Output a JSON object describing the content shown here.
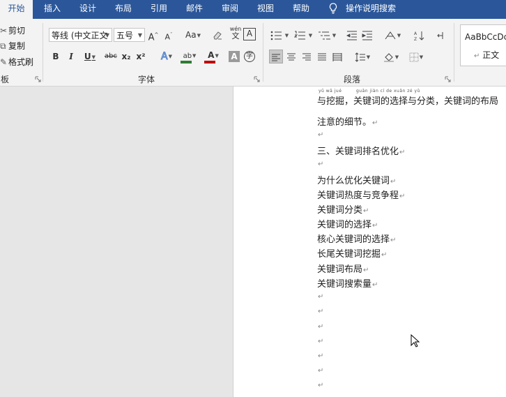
{
  "tabs": [
    "开始",
    "插入",
    "设计",
    "布局",
    "引用",
    "邮件",
    "审阅",
    "视图",
    "帮助"
  ],
  "tell_me": "操作说明搜索",
  "clipboard": {
    "cut": "剪切",
    "copy": "复制",
    "format_painter": "格式刷",
    "group_label": "板"
  },
  "font": {
    "font_name": "等线 (中文正文",
    "font_size": "五号",
    "grow": "A",
    "shrink": "A",
    "change_case": "Aa",
    "phonetic_top": "wén",
    "phonetic_bottom": "文",
    "border_char": "A",
    "bold": "B",
    "italic": "I",
    "underline": "U",
    "strike": "abc",
    "subscript": "x₂",
    "superscript": "x²",
    "effects": "A",
    "highlight": "ab",
    "font_color": "A",
    "shading_char": "A",
    "enclose_char": "字",
    "group_label": "字体"
  },
  "paragraph": {
    "group_label": "段落"
  },
  "styles": {
    "preview": "AaBbCcDc",
    "normal": "正文"
  },
  "colors": {
    "tab_bar": "#2b579a",
    "ribbon": "#f3f3f3",
    "highlight_bar": "#2e7d32",
    "font_color_bar": "#c00000"
  },
  "document": {
    "pinyin_1": "yǔ wā jué",
    "pinyin_2": "guān jiàn cí de xuǎn zé yǔ",
    "lines": [
      "与挖掘，关键词的选择与分类，关键词的布局",
      "注意的细节。",
      "",
      "三、关键词排名优化",
      "",
      "为什么优化关键词",
      "关键词热度与竞争程",
      "关键词分类",
      "关键词的选择",
      "核心关键词的选择",
      "长尾关键词挖掘",
      "关键词布局",
      "关键词搜索量",
      "",
      "",
      "",
      "",
      "",
      "",
      ""
    ]
  }
}
